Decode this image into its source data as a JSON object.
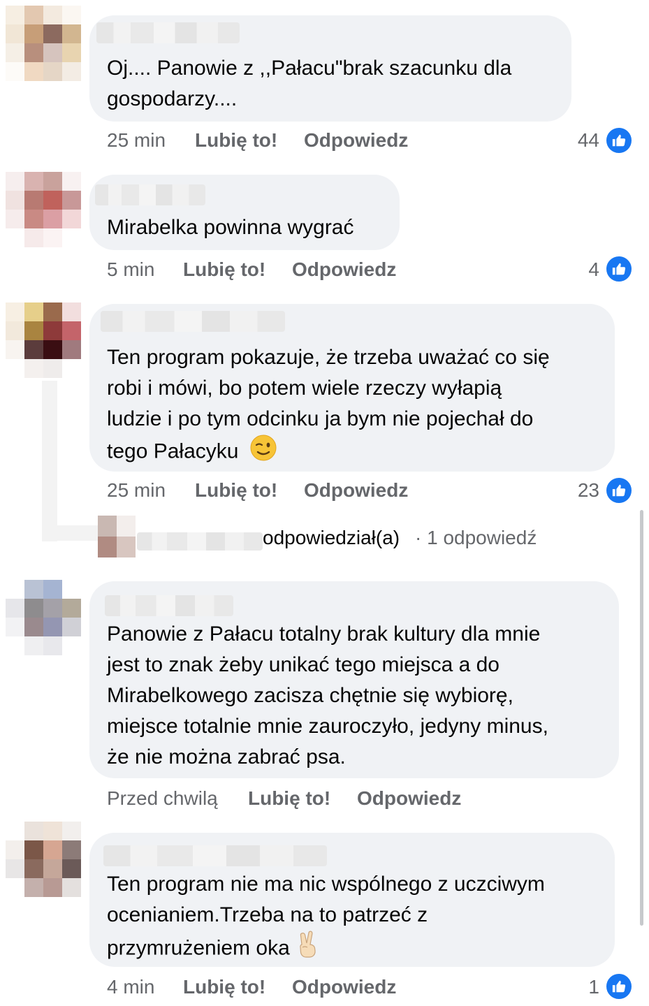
{
  "comments": [
    {
      "text_lines": [
        "Oj.... Panowie z ,,Pałacu\"brak szacunku dla",
        "gospodarzy...."
      ],
      "time": "25 min",
      "like": "Lubię to!",
      "reply": "Odpowiedz",
      "reactions": "44"
    },
    {
      "text_lines": [
        "Mirabelka powinna wygrać"
      ],
      "time": "5 min",
      "like": "Lubię to!",
      "reply": "Odpowiedz",
      "reactions": "4"
    },
    {
      "text_lines": [
        "Ten program pokazuje, że trzeba uważać co się",
        "robi i mówi, bo potem wiele rzeczy wyłapią",
        "ludzie i po tym odcinku ja bym nie pojechał do",
        "tego Pałacyku"
      ],
      "time": "25 min",
      "like": "Lubię to!",
      "reply": "Odpowiedz",
      "reactions": "23"
    },
    {
      "text_lines": [
        "Panowie z Pałacu totalny brak kultury dla mnie",
        "jest to znak żeby unikać tego miejsca a do",
        "Mirabelkowego zacisza chętnie się wybiorę,",
        "miejsce totalnie mnie zauroczyło, jedyny minus,",
        "że nie można zabrać psa."
      ],
      "time": "Przed chwilą",
      "like": "Lubię to!",
      "reply": "Odpowiedz"
    },
    {
      "text_lines": [
        "Ten program nie ma nic wspólnego z uczciwym",
        "ocenianiem.Trzeba na to patrzeć z",
        "przymrużeniem oka"
      ],
      "time": "4 min",
      "like": "Lubię to!",
      "reply": "Odpowiedz",
      "reactions": "1"
    }
  ],
  "reply_thread": {
    "action": "odpowiedział(a)",
    "count": "· 1 odpowiedź"
  },
  "colors": {
    "bubble": "#f0f2f5",
    "like_blue": "#1877f2",
    "meta_gray": "#65676b"
  },
  "icons": [
    "like-thumb-icon",
    "wink-emoji-icon",
    "victory-hand-emoji-icon"
  ]
}
